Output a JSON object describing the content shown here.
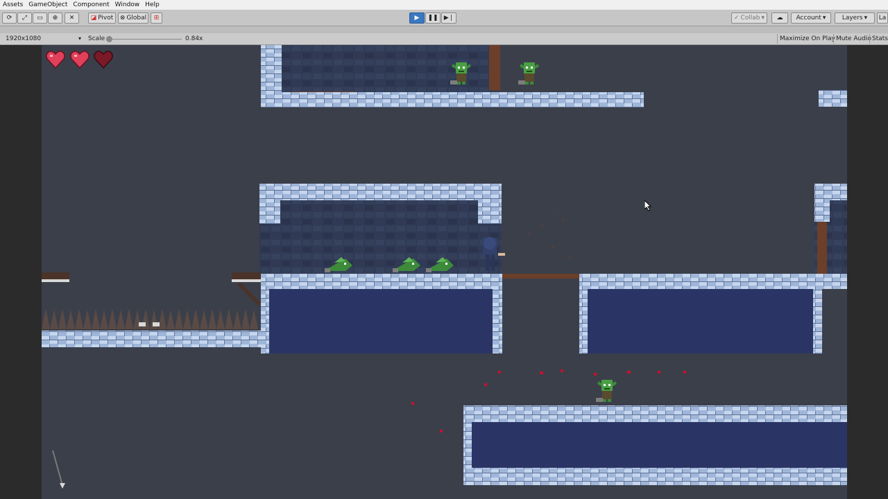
{
  "menu": {
    "items": [
      "Assets",
      "GameObject",
      "Component",
      "Window",
      "Help"
    ]
  },
  "toolbar": {
    "pivot_label": "Pivot",
    "global_label": "Global",
    "collab_label": "Collab",
    "account_label": "Account",
    "layers_label": "Layers"
  },
  "game_view": {
    "resolution": "1920x1080",
    "scale_label": "Scale",
    "scale_value": "0.84x",
    "maximize_label": "Maximize On Play",
    "mute_label": "Mute Audio",
    "stats_label": "Stats"
  },
  "hud": {
    "hearts_total": 3,
    "hearts_full": 2
  },
  "colors": {
    "sky": "#3b3f4a",
    "stone": "#a8bfe0",
    "stone_dark": "#5a6e96",
    "wall": "#2f3a55",
    "water": "#2a3566",
    "goblin": "#3d8a3a",
    "heart": "#e0405a",
    "heart_empty": "#7a1a28",
    "wood": "#6b3f2a",
    "blood": "#c8102e"
  }
}
